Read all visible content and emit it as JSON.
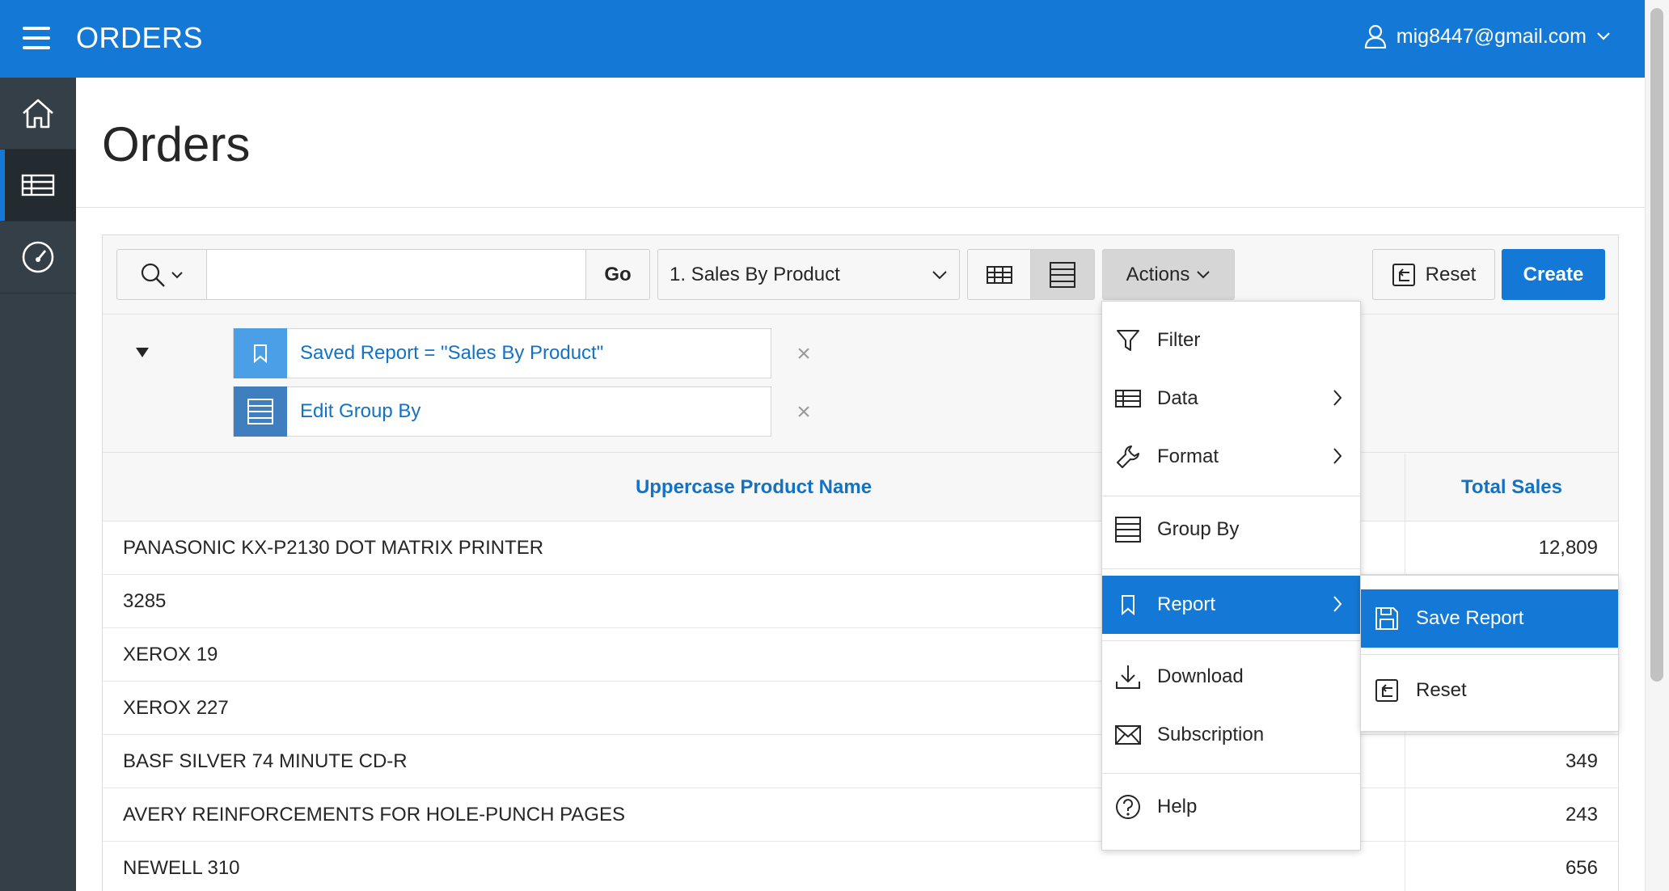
{
  "header": {
    "app_title": "ORDERS",
    "user_email": "mig8447@gmail.com"
  },
  "nav": {
    "items": [
      {
        "name": "home",
        "icon": "home-icon",
        "active": false
      },
      {
        "name": "orders-report",
        "icon": "table-icon",
        "active": true
      },
      {
        "name": "dashboard",
        "icon": "gauge-icon",
        "active": false
      }
    ]
  },
  "page": {
    "title": "Orders"
  },
  "toolbar": {
    "search_value": "",
    "go_label": "Go",
    "saved_report": "1. Sales By Product",
    "actions_label": "Actions",
    "reset_label": "Reset",
    "create_label": "Create"
  },
  "settings": {
    "rows": [
      {
        "label": "Saved Report = \"Sales By Product\"",
        "icon": "bookmark-icon",
        "icon_bg": "#4a9fe6"
      },
      {
        "label": "Edit Group By",
        "icon": "group-by-icon",
        "icon_bg": "#3f7fbf"
      }
    ]
  },
  "table": {
    "columns": [
      "Uppercase Product Name",
      "Total Sales"
    ],
    "rows": [
      {
        "name": "PANASONIC KX-P2130 DOT MATRIX PRINTER",
        "sales": "12,809"
      },
      {
        "name": "3285",
        "sales": ""
      },
      {
        "name": "XEROX 19",
        "sales": ""
      },
      {
        "name": "XEROX 227",
        "sales": ""
      },
      {
        "name": "BASF SILVER 74 MINUTE CD-R",
        "sales": "349"
      },
      {
        "name": "AVERY REINFORCEMENTS FOR HOLE-PUNCH PAGES",
        "sales": "243"
      },
      {
        "name": "NEWELL 310",
        "sales": "656"
      }
    ]
  },
  "actions_menu": {
    "items": [
      {
        "label": "Filter",
        "icon": "filter-icon",
        "submenu": false
      },
      {
        "label": "Data",
        "icon": "table-icon",
        "submenu": true
      },
      {
        "label": "Format",
        "icon": "wrench-icon",
        "submenu": true
      },
      {
        "label": "Group By",
        "icon": "group-by-icon",
        "submenu": false
      },
      {
        "label": "Report",
        "icon": "bookmark-icon",
        "submenu": true,
        "active": true
      },
      {
        "label": "Download",
        "icon": "download-icon",
        "submenu": false
      },
      {
        "label": "Subscription",
        "icon": "envelope-icon",
        "submenu": false
      },
      {
        "label": "Help",
        "icon": "help-icon",
        "submenu": false
      }
    ]
  },
  "report_submenu": {
    "items": [
      {
        "label": "Save Report",
        "icon": "save-icon",
        "active": true
      },
      {
        "label": "Reset",
        "icon": "reset-icon",
        "active": false
      }
    ]
  },
  "colors": {
    "accent": "#1479d6",
    "nav_bg": "#343f48",
    "link": "#1372c4"
  }
}
